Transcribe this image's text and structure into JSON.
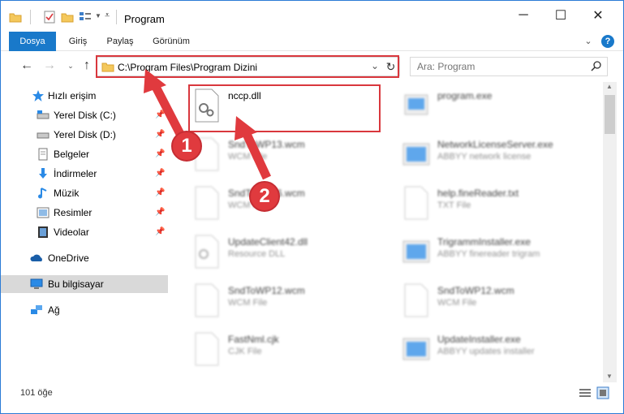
{
  "window": {
    "title": "Program",
    "minimize": "─",
    "maximize": "☐",
    "close": "✕"
  },
  "ribbon": {
    "tabs": [
      "Dosya",
      "Giriş",
      "Paylaş",
      "Görünüm"
    ],
    "help": "?"
  },
  "address": {
    "path": "C:\\Program Files\\Program Dizini",
    "search_placeholder": "Ara: Program"
  },
  "sidebar": {
    "items": [
      {
        "label": "Hızlı erişim",
        "icon": "star-icon",
        "pinned": false
      },
      {
        "label": "Yerel Disk (C:)",
        "icon": "drive-icon",
        "pinned": true
      },
      {
        "label": "Yerel Disk (D:)",
        "icon": "drive-icon",
        "pinned": true
      },
      {
        "label": "Belgeler",
        "icon": "documents-icon",
        "pinned": true
      },
      {
        "label": "İndirmeler",
        "icon": "download-icon",
        "pinned": true
      },
      {
        "label": "Müzik",
        "icon": "music-icon",
        "pinned": true
      },
      {
        "label": "Resimler",
        "icon": "pictures-icon",
        "pinned": true
      },
      {
        "label": "Videolar",
        "icon": "video-icon",
        "pinned": true
      },
      {
        "label": "OneDrive",
        "icon": "cloud-icon",
        "pinned": false
      },
      {
        "label": "Bu bilgisayar",
        "icon": "computer-icon",
        "pinned": false,
        "selected": true
      },
      {
        "label": "Ağ",
        "icon": "network-icon",
        "pinned": false
      }
    ]
  },
  "files": {
    "left": [
      {
        "name": "nccp.dll",
        "type": ""
      },
      {
        "name": "SndToWP13.wcm",
        "type": "WCM File"
      },
      {
        "name": "SndToWP16.wcm",
        "type": "WCM File"
      },
      {
        "name": "UpdateClient42.dll",
        "type": "Resource DLL"
      },
      {
        "name": "SndToWP12.wcm",
        "type": "WCM File"
      },
      {
        "name": "FastNml.cjk",
        "type": "CJK File"
      }
    ],
    "right": [
      {
        "name": "program.exe",
        "type": ""
      },
      {
        "name": "NetworkLicenseServer.exe",
        "type": "ABBYY network license"
      },
      {
        "name": "help.fineReader.txt",
        "type": "TXT File"
      },
      {
        "name": "TrigrammInstaller.exe",
        "type": "ABBYY finereader trigram"
      },
      {
        "name": "SndToWP12.wcm",
        "type": "WCM File"
      },
      {
        "name": "UpdateInstaller.exe",
        "type": "ABBYY updates installer"
      }
    ]
  },
  "status": {
    "count": "101 öğe"
  },
  "annotations": {
    "callout1": "1",
    "callout2": "2",
    "color": "#d9373d"
  },
  "colors": {
    "accent": "#1979ca",
    "selected": "#d9d9d9"
  }
}
